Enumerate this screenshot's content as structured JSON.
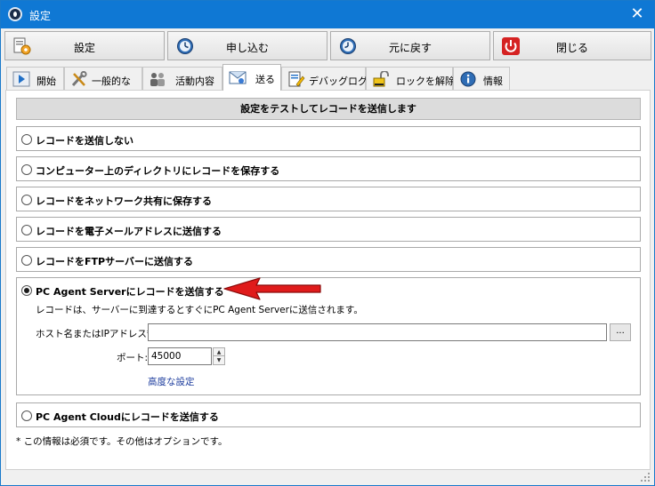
{
  "window": {
    "title": "設定",
    "close_glyph": "✕"
  },
  "toolbar": {
    "buttons": [
      {
        "label": "設定",
        "icon": "settings-doc-icon"
      },
      {
        "label": "申し込む",
        "icon": "apply-clock-icon"
      },
      {
        "label": "元に戻す",
        "icon": "revert-clock-icon"
      },
      {
        "label": "閉じる",
        "icon": "power-icon"
      }
    ]
  },
  "tabs": [
    {
      "label": "開始",
      "icon": "play-icon"
    },
    {
      "label": "一般的な",
      "icon": "tools-icon"
    },
    {
      "label": "活動内容",
      "icon": "people-icon"
    },
    {
      "label": "送る",
      "icon": "send-mail-icon",
      "active": true
    },
    {
      "label": "デバッグログ",
      "icon": "edit-doc-icon"
    },
    {
      "label": "ロックを解除",
      "icon": "unlock-icon"
    },
    {
      "label": "情報",
      "icon": "info-icon"
    }
  ],
  "send_panel": {
    "header": "設定をテストしてレコードを送信します",
    "options": [
      {
        "label": "レコードを送信しない",
        "selected": false
      },
      {
        "label": "コンピューター上のディレクトリにレコードを保存する",
        "selected": false
      },
      {
        "label": "レコードをネットワーク共有に保存する",
        "selected": false
      },
      {
        "label": "レコードを電子メールアドレスに送信する",
        "selected": false
      },
      {
        "label": "レコードをFTPサーバーに送信する",
        "selected": false
      },
      {
        "label": "PC Agent Serverにレコードを送信する",
        "selected": true
      },
      {
        "label": "PC Agent Cloudにレコードを送信する",
        "selected": false
      }
    ],
    "server": {
      "description": "レコードは、サーバーに到達するとすぐにPC Agent Serverに送信されます。",
      "host_label": "ホスト名またはIPアドレス*:",
      "host_value": "",
      "browse_label": "...",
      "port_label": "ポート:",
      "port_value": "45000",
      "advanced_link": "高度な設定"
    },
    "footnote": "* この情報は必須です。その他はオプションです。"
  },
  "colors": {
    "titlebar": "#0f78d4",
    "arrow": "#e01b1b",
    "link": "#1a3a9c"
  }
}
